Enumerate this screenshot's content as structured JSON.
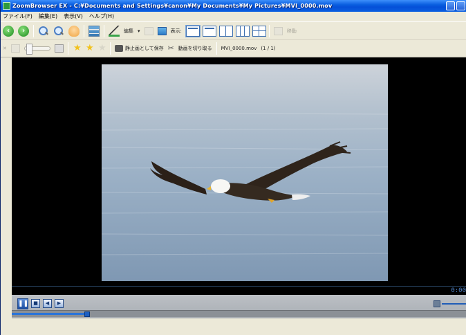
{
  "window": {
    "title": "ZoomBrowser EX - C:¥Documents and Settings¥canon¥My Documents¥My Pictures¥MVI_0000.mov"
  },
  "menu": {
    "items": [
      "ファイル(F)",
      "編集(E)",
      "表示(V)",
      "ヘルプ(H)"
    ]
  },
  "toolbar1": {
    "edit_label": "編集",
    "view_label": "表示:",
    "move_label": "移動"
  },
  "toolbar2": {
    "save_still_label": "静止画として保存",
    "cut_movie_label": "動画を切り取る",
    "file_name": "MVI_0000.mov",
    "file_counter": "(1 / 1)"
  },
  "player": {
    "time_display": "0:00",
    "seek_position": 0.165
  },
  "colors": {
    "title_bar": "#0a5fe0",
    "video_background": "#000000",
    "accent": "#1e60c2"
  },
  "icons": {
    "back": "arrow-left-icon",
    "forward": "arrow-right-icon",
    "zoom_in": "zoom-in-icon",
    "zoom_out": "zoom-out-icon"
  }
}
